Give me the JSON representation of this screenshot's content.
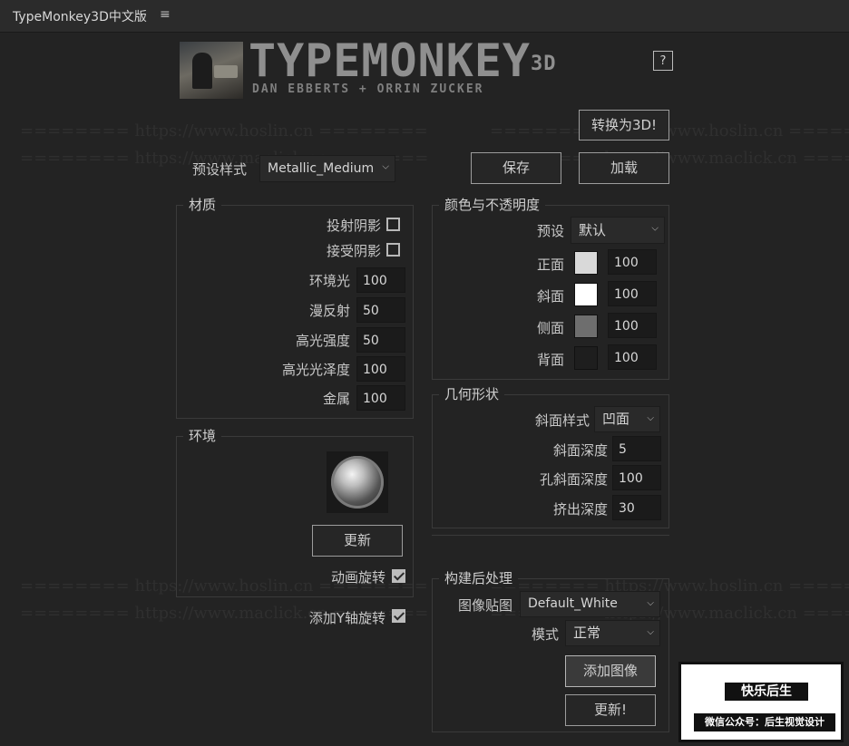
{
  "window": {
    "title": "TypeMonkey3D中文版",
    "menu_icon": "hamburger-menu-icon"
  },
  "logo": {
    "title": "TYPEMONKEY",
    "title_sup": "3D",
    "subtitle": "DAN EBBERTS + ORRIN ZUCKER"
  },
  "help_label": "?",
  "convert_label": "转换为3D!",
  "preset": {
    "label": "预设样式",
    "value": "Metallic_Medium"
  },
  "save_label": "保存",
  "load_label": "加载",
  "watermarks": [
    "======== https://www.hoslin.cn ========",
    "======== https://www.maclick.cn ======="
  ],
  "material": {
    "title": "材质",
    "cast_shadows": {
      "label": "投射阴影",
      "checked": false
    },
    "accept_shadows": {
      "label": "接受阴影",
      "checked": false
    },
    "fields": [
      {
        "label": "环境光",
        "value": "100"
      },
      {
        "label": "漫反射",
        "value": "50"
      },
      {
        "label": "高光强度",
        "value": "50"
      },
      {
        "label": "高光光泽度",
        "value": "100"
      },
      {
        "label": "金属",
        "value": "100"
      }
    ]
  },
  "color": {
    "title": "颜色与不透明度",
    "preset_label": "预设",
    "preset_value": "默认",
    "rows": [
      {
        "label": "正面",
        "color": "#d9d9d9",
        "value": "100"
      },
      {
        "label": "斜面",
        "color": "#ffffff",
        "value": "100"
      },
      {
        "label": "侧面",
        "color": "#6e6e6e",
        "value": "100"
      },
      {
        "label": "背面",
        "color": "#1e1e1e",
        "value": "100"
      }
    ]
  },
  "environment": {
    "title": "环境",
    "update_label": "更新",
    "animate_rotation": {
      "label": "动画旋转",
      "checked": true
    }
  },
  "geometry": {
    "title": "几何形状",
    "bevel_style": {
      "label": "斜面样式",
      "value": "凹面"
    },
    "fields": [
      {
        "label": "斜面深度",
        "value": "5"
      },
      {
        "label": "孔斜面深度",
        "value": "100"
      },
      {
        "label": "挤出深度",
        "value": "30"
      }
    ]
  },
  "add_y_rotation": {
    "label": "添加Y轴旋转",
    "checked": true
  },
  "post": {
    "title": "构建后处理",
    "image_map": {
      "label": "图像贴图",
      "value": "Default_White"
    },
    "mode": {
      "label": "模式",
      "value": "正常"
    },
    "add_image_label": "添加图像",
    "update_label": "更新!"
  },
  "promo": {
    "title": "快乐后生",
    "subtitle": "微信公众号：后生视觉设计"
  },
  "colors": {
    "background": "#232323",
    "button_border": "#9c9c9c"
  }
}
